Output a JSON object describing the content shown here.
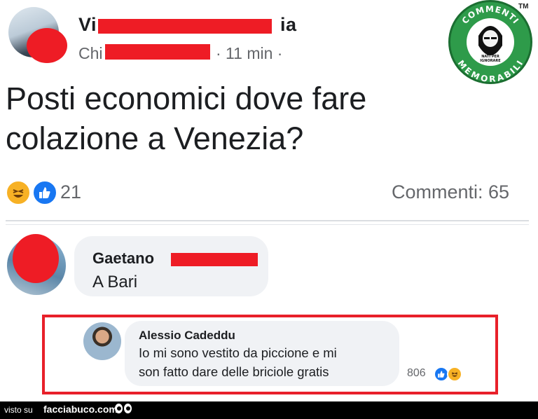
{
  "post": {
    "author_visible_start": "Vi",
    "author_visible_end": "ia",
    "subtitle_visible_start": "Chi",
    "time": "· 11 min ·",
    "text_line1": "Posti economici dove fare",
    "text_line2": "colazione a Venezia?",
    "reactions_count": "21",
    "comments_label": "Commenti: 65"
  },
  "comments": [
    {
      "author_visible": "Gaetano",
      "text": "A Bari"
    },
    {
      "author": "Alessio Cadeddu",
      "text_line1": "Io mi sono vestito da piccione e mi",
      "text_line2": "son fatto dare delle briciole gratis",
      "likes": "806"
    }
  ],
  "logo": {
    "top_text": "COMMENTI",
    "bottom_text": "MEMORABILI",
    "tagline_line1": "NATI PER",
    "tagline_line2": "IGNORARE",
    "trademark": "TM"
  },
  "footer": {
    "visto_su": "visto su",
    "site": "facciabuco.com"
  },
  "colors": {
    "redaction": "#ee1c25",
    "highlight_border": "#e8202a",
    "logo_green": "#2e9b4a",
    "like_blue": "#1877f2",
    "haha_yellow": "#f7b125"
  },
  "icons": [
    "haha-emoji-icon",
    "like-thumb-icon",
    "eyes-icon",
    "logo-icon"
  ]
}
